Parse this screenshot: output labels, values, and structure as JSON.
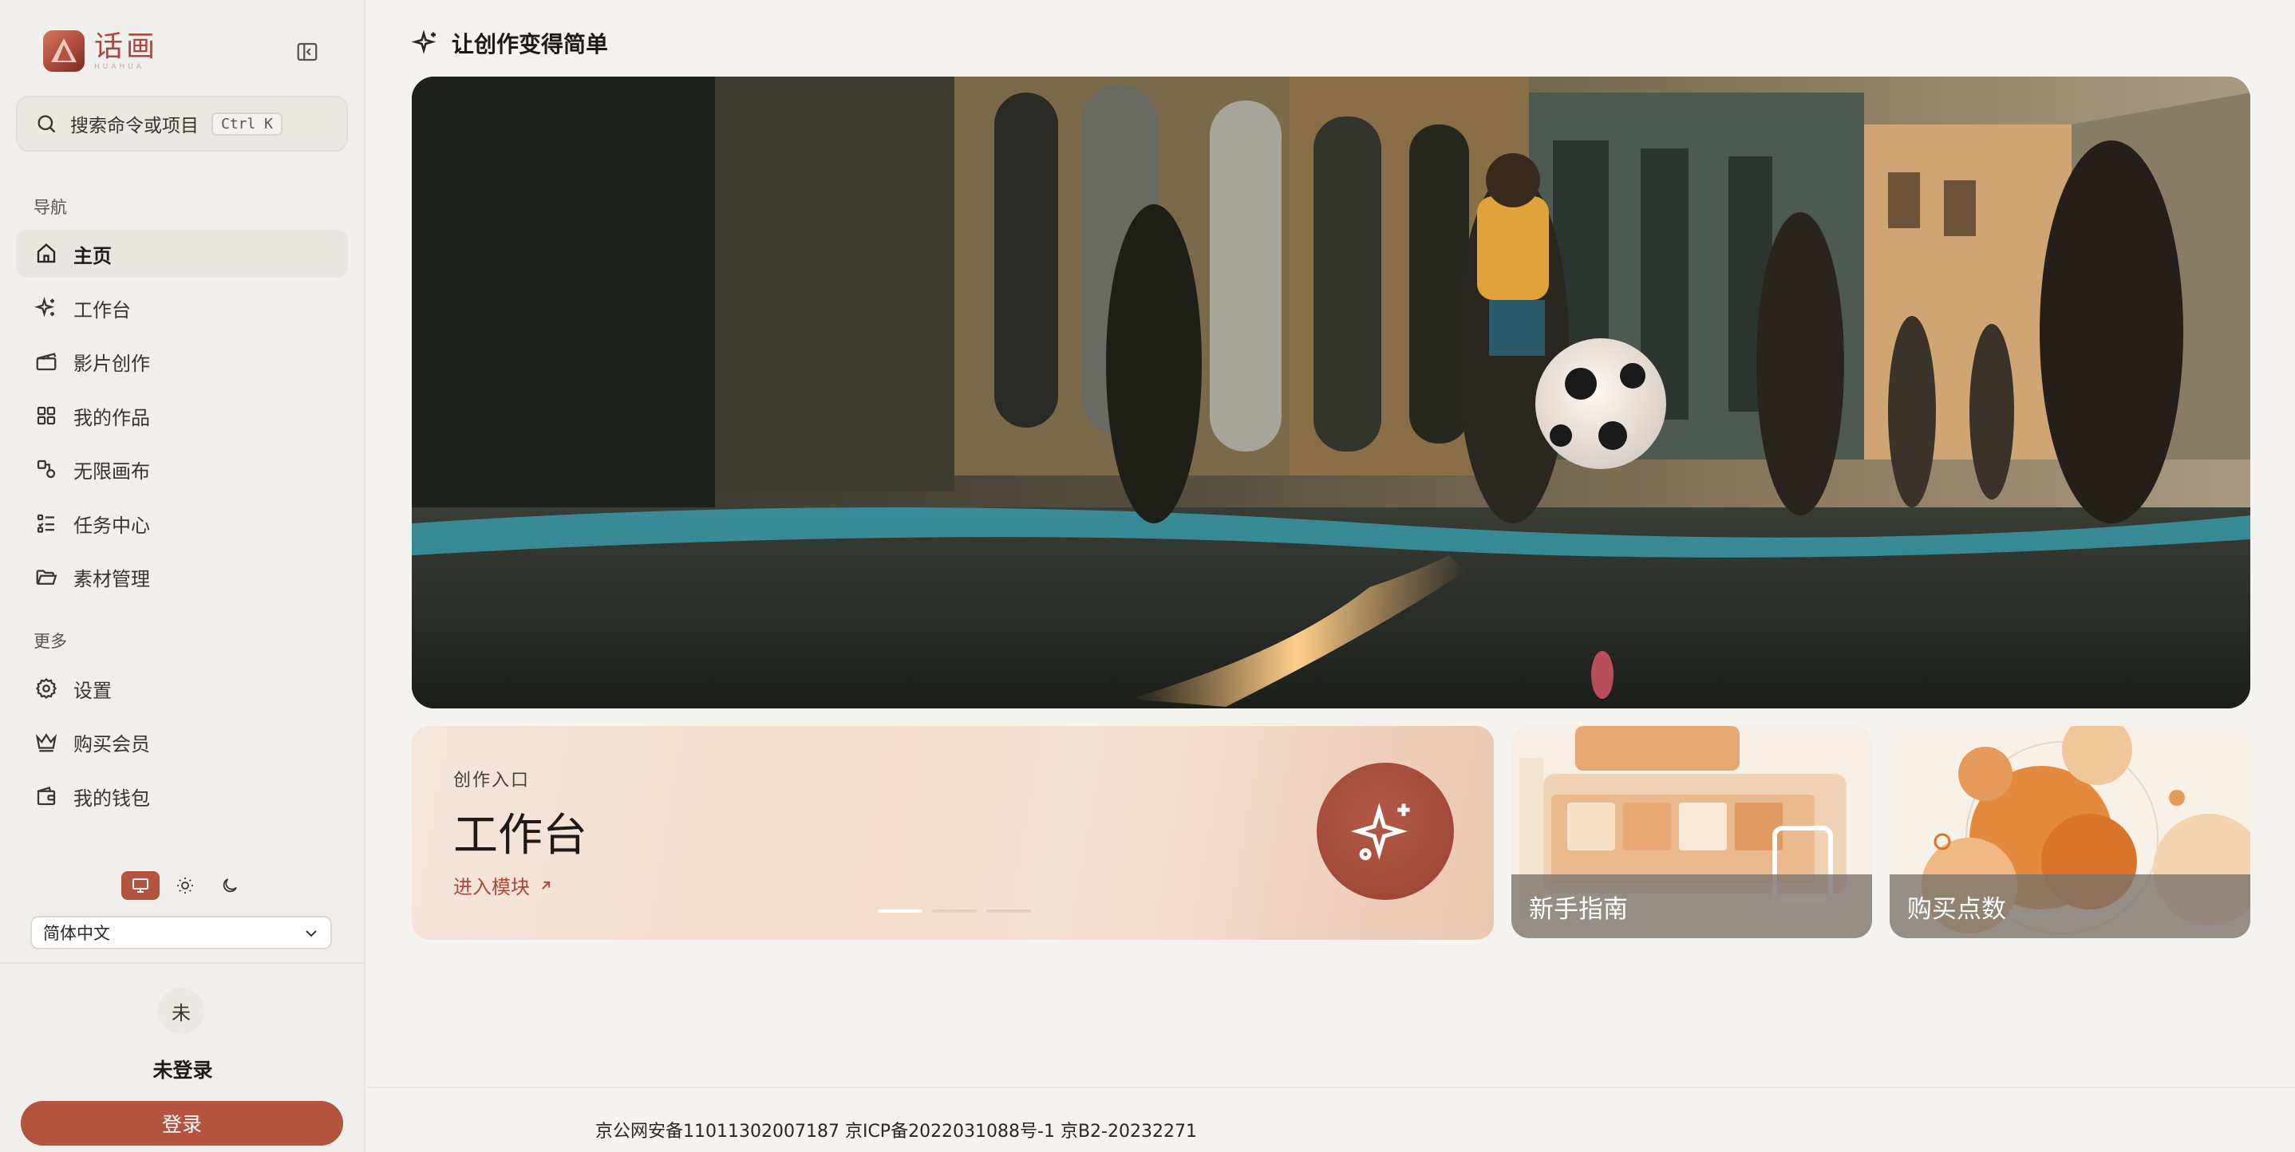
{
  "app": {
    "name": "话画",
    "sub": "HUAHUA"
  },
  "search": {
    "label": "搜索命令或项目",
    "shortcut": "Ctrl K"
  },
  "nav": {
    "section_title": "导航",
    "items": [
      {
        "label": "主页",
        "icon": "home-icon"
      },
      {
        "label": "工作台",
        "icon": "sparkles-icon"
      },
      {
        "label": "影片创作",
        "icon": "clapperboard-icon"
      },
      {
        "label": "我的作品",
        "icon": "grid-icon"
      },
      {
        "label": "无限画布",
        "icon": "canvas-shapes-icon"
      },
      {
        "label": "任务中心",
        "icon": "task-list-icon"
      },
      {
        "label": "素材管理",
        "icon": "folder-icon"
      }
    ]
  },
  "more": {
    "section_title": "更多",
    "items": [
      {
        "label": "设置",
        "icon": "gear-icon"
      },
      {
        "label": "购买会员",
        "icon": "crown-icon"
      },
      {
        "label": "我的钱包",
        "icon": "wallet-icon"
      }
    ]
  },
  "theme": {
    "options": [
      "monitor-icon",
      "sun-icon",
      "moon-icon"
    ],
    "selected": "monitor-icon"
  },
  "language": {
    "selected": "简体中文"
  },
  "user": {
    "avatar_text": "未",
    "name": "未登录",
    "login_label": "登录"
  },
  "page": {
    "title": "让创作变得简单"
  },
  "cards": {
    "main": {
      "eyebrow": "创作入口",
      "title": "工作台",
      "link": "进入模块"
    },
    "guide": {
      "caption": "新手指南"
    },
    "points": {
      "caption": "购买点数"
    }
  },
  "carousel": {
    "count": 3,
    "active": 0
  },
  "footer": {
    "text": "京公网安备11011302007187 京ICP备2022031088号-1 京B2-20232271"
  },
  "colors": {
    "accent": "#b4533e",
    "brand": "#a9493d",
    "background": "#f5f3ef",
    "sidebar": "#f1efec"
  }
}
